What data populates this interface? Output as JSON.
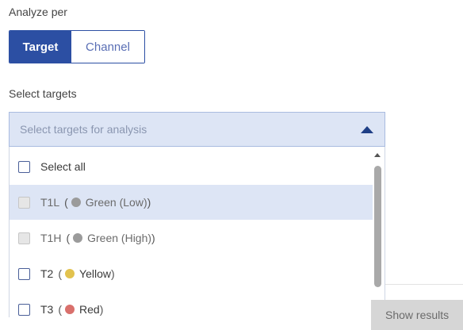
{
  "analyze_per": {
    "label": "Analyze per",
    "options": [
      "Target",
      "Channel"
    ],
    "selected": "Target"
  },
  "select_targets": {
    "label": "Select targets",
    "placeholder": "Select targets for analysis",
    "select_all_label": "Select all",
    "items": [
      {
        "name": "T1L",
        "channel": "Green (Low)",
        "color": "#9b9b9b",
        "disabled": true,
        "highlighted": true
      },
      {
        "name": "T1H",
        "channel": "Green (High)",
        "color": "#9b9b9b",
        "disabled": true,
        "highlighted": false
      },
      {
        "name": "T2",
        "channel": "Yellow",
        "color": "#e2c24e",
        "disabled": false,
        "highlighted": false
      },
      {
        "name": "T3",
        "channel": "Red",
        "color": "#d9706c",
        "disabled": false,
        "highlighted": false
      }
    ]
  },
  "actions": {
    "show_results_label": "Show results"
  },
  "icons": {
    "dropdown": "caret-up-icon",
    "scroll_up": "scroll-up-arrow-icon",
    "scroll_down": "scroll-down-arrow-icon"
  },
  "colors": {
    "accent": "#2c4fa3",
    "highlight": "#dde5f5"
  }
}
